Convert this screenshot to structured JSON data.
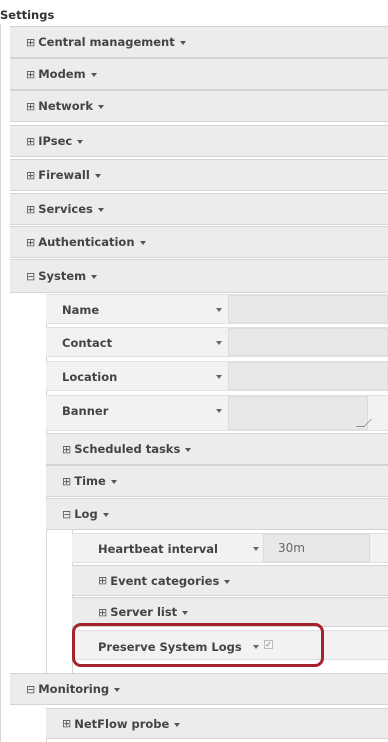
{
  "title": "Settings",
  "sections": {
    "central_management": "Central management",
    "modem": "Modem",
    "network": "Network",
    "ipsec": "IPsec",
    "firewall": "Firewall",
    "services": "Services",
    "authentication": "Authentication",
    "system": "System",
    "monitoring": "Monitoring"
  },
  "system": {
    "name_label": "Name",
    "contact_label": "Contact",
    "location_label": "Location",
    "banner_label": "Banner",
    "scheduled_tasks": "Scheduled tasks",
    "time": "Time",
    "log": "Log"
  },
  "log": {
    "heartbeat_label": "Heartbeat interval",
    "heartbeat_value": "30m",
    "event_categories": "Event categories",
    "server_list": "Server list",
    "preserve_label": "Preserve System Logs",
    "preserve_checked": true
  },
  "monitoring": {
    "netflow_probe": "NetFlow probe"
  },
  "glyphs": {
    "expand": "⊞",
    "collapse": "⊟",
    "check": "✓"
  },
  "colors": {
    "highlight": "#a4232b"
  }
}
